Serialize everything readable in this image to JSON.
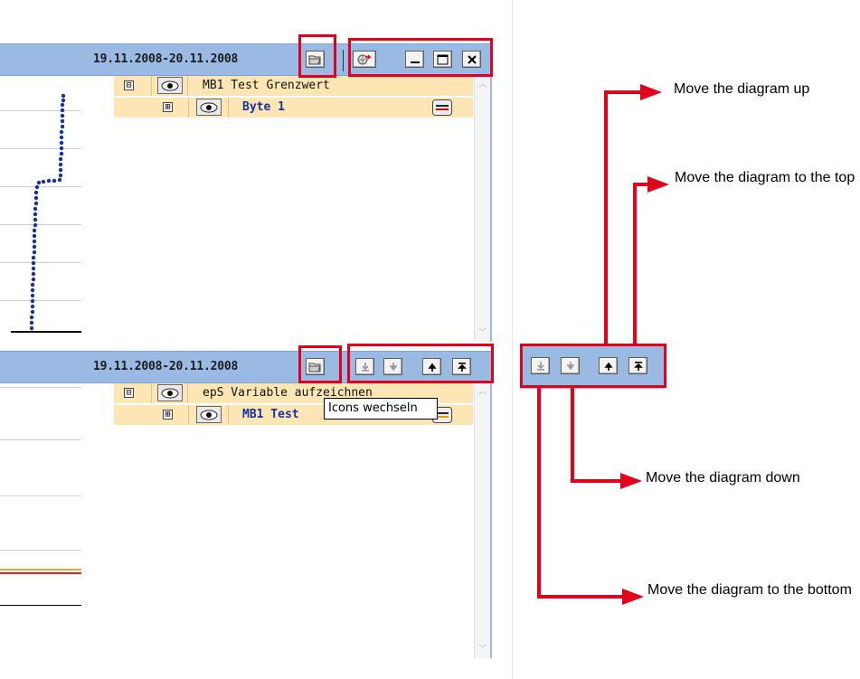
{
  "colors": {
    "header": "#9ab9e3",
    "highlight_box": "#e2001a",
    "row_bg": "#fde6b4",
    "arrow": "#e2001a",
    "chart_points": "#1a2fa0"
  },
  "panel_top": {
    "date": "19.11.2008-20.11.2008",
    "icons": [
      "folder-open-icon",
      "network-globe-icon",
      "minimize-icon",
      "maximize-icon",
      "close-icon"
    ],
    "rows": [
      {
        "expander": "⊟",
        "label": "MB1 Test Grenzwert",
        "bold": false
      },
      {
        "expander": "⊞",
        "label": "Byte 1",
        "bold": true
      }
    ]
  },
  "panel_bottom": {
    "date": "19.11.2008-20.11.2008",
    "icons": [
      "folder-open-icon",
      "move-to-bottom-icon",
      "move-down-icon",
      "move-up-icon",
      "move-to-top-icon"
    ],
    "rows": [
      {
        "expander": "⊟",
        "label": "epS Variable aufzeichnen",
        "bold": false
      },
      {
        "expander": "⊞",
        "label": "MB1 Test",
        "bold": true
      }
    ],
    "tooltip": "Icons wechseln"
  },
  "annotations": {
    "up": "Move the diagram up",
    "top": "Move the diagram to the top",
    "down": "Move the diagram down",
    "bottom": "Move the diagram to the bottom"
  }
}
